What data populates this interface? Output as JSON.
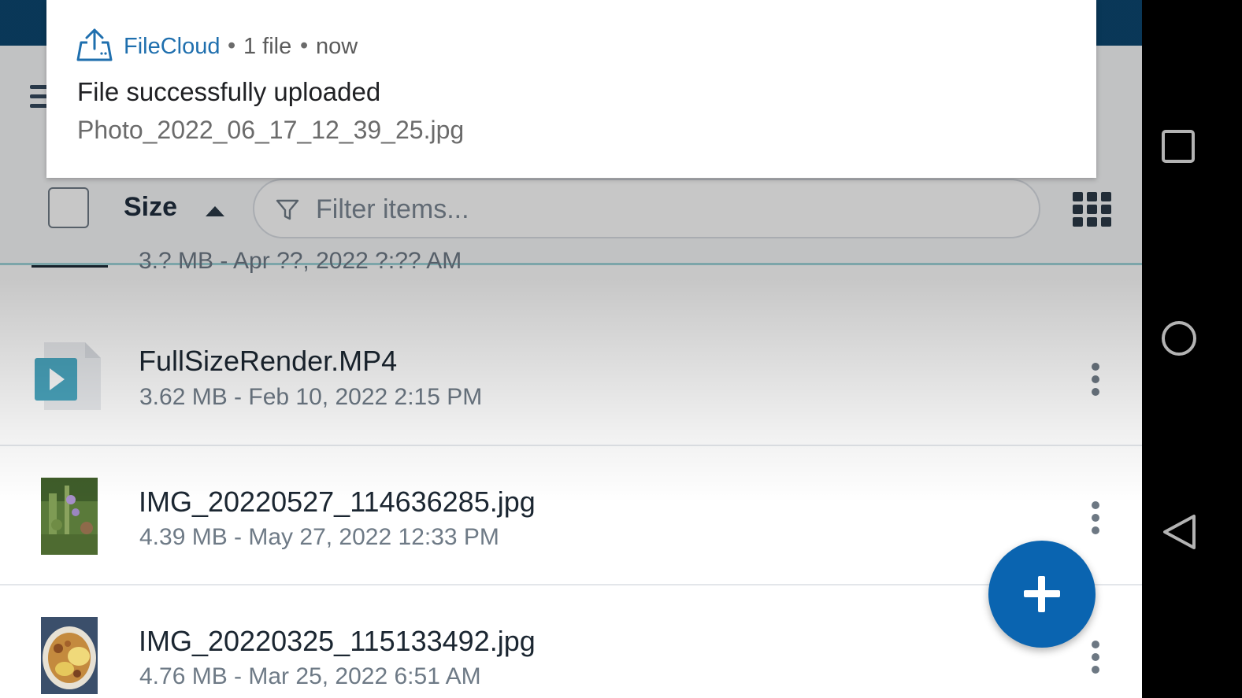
{
  "notification": {
    "app_name": "FileCloud",
    "separator": "•",
    "count": "1 file",
    "time": "now",
    "title": "File successfully uploaded",
    "body": "Photo_2022_06_17_12_39_25.jpg",
    "accent_color": "#1f6fae"
  },
  "toolbar": {
    "sort_label": "Size",
    "sort_direction": "ascending",
    "filter_placeholder": "Filter items..."
  },
  "files": {
    "partial": {
      "meta": "3.? MB - Apr ??, 2022 ?:?? AM"
    },
    "items": [
      {
        "name": "FullSizeRender.MP4",
        "meta": "3.62 MB - Feb 10, 2022 2:15 PM",
        "icon": "video-file-icon"
      },
      {
        "name": "IMG_20220527_114636285.jpg",
        "meta": "4.39 MB - May 27, 2022 12:33 PM",
        "icon": "image-thumbnail"
      },
      {
        "name": "IMG_20220325_115133492.jpg",
        "meta": "4.76 MB - Mar 25, 2022 6:51 AM",
        "icon": "image-thumbnail"
      }
    ]
  },
  "colors": {
    "status_bar": "#0c4670",
    "fab": "#0a64b0",
    "video_icon": "#4aa6bf"
  }
}
